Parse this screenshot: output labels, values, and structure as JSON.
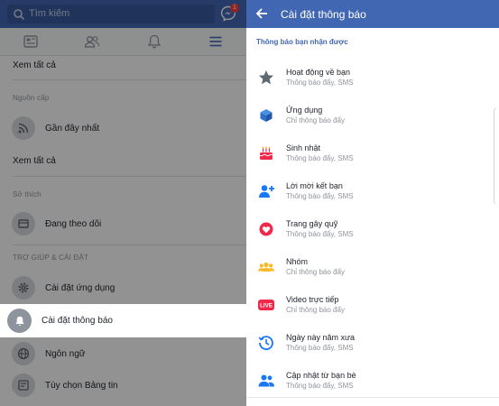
{
  "left": {
    "search_placeholder": "Tìm kiếm",
    "messenger_badge": "1",
    "tabs": [
      "news-feed",
      "friends",
      "notifications",
      "menu"
    ],
    "see_all_1": "Xem tất cả",
    "section_feeds": "Nguồn cấp",
    "recent": "Gần đây nhất",
    "see_all_2": "Xem tất cả",
    "section_interests": "Sở thích",
    "following": "Đang theo dõi",
    "section_help": "TRỢ GIÚP & CÀI ĐẶT",
    "app_settings": "Cài đặt ứng dụng",
    "notification_settings": "Cài đặt thông báo",
    "language": "Ngôn ngữ",
    "news_feed_prefs": "Tùy chọn Bảng tin"
  },
  "right": {
    "title": "Cài đặt thông báo",
    "subheading": "Thông báo bạn nhận được",
    "items": [
      {
        "name": "Hoạt động về bạn",
        "sub": "Thông báo đẩy, SMS",
        "icon": "star-icon"
      },
      {
        "name": "Ứng dụng",
        "sub": "Chỉ thông báo đẩy",
        "icon": "app-cube-icon"
      },
      {
        "name": "Sinh nhật",
        "sub": "Thông báo đẩy, SMS",
        "icon": "birthday-cake-icon"
      },
      {
        "name": "Lời mời kết bạn",
        "sub": "Thông báo đẩy, SMS",
        "icon": "friend-request-icon"
      },
      {
        "name": "Trang gây quỹ",
        "sub": "Thông báo đẩy, SMS",
        "icon": "fundraiser-icon"
      },
      {
        "name": "Nhóm",
        "sub": "Chỉ thông báo đẩy",
        "icon": "groups-icon"
      },
      {
        "name": "Video trực tiếp",
        "sub": "Chỉ thông báo đẩy",
        "icon": "live-video-icon"
      },
      {
        "name": "Ngày này năm xưa",
        "sub": "Thông báo đẩy, SMS",
        "icon": "memories-clock-icon"
      },
      {
        "name": "Cập nhật từ bạn bè",
        "sub": "Thông báo đẩy, SMS",
        "icon": "friends-updates-icon"
      }
    ]
  },
  "live_badge_text": "LIVE",
  "colors": {
    "brand_blue": "#4267b2",
    "overlay": "rgba(0,0,0,0.42)",
    "red": "#f02849",
    "yellow": "#f7b928"
  }
}
